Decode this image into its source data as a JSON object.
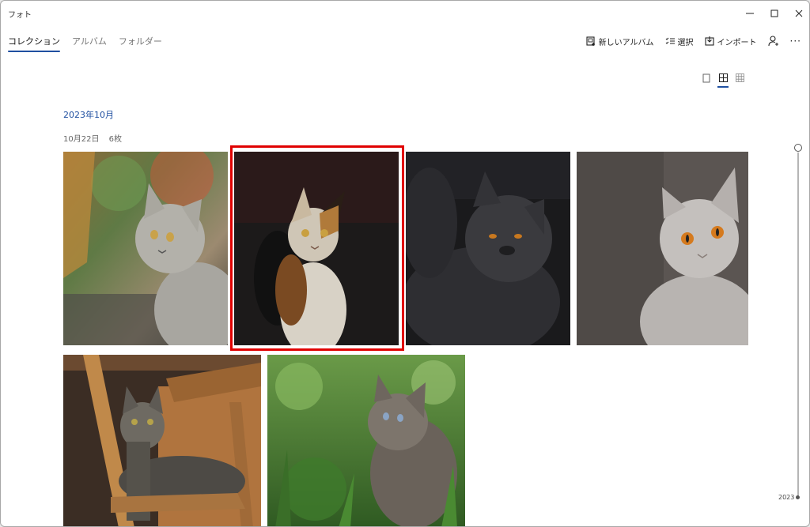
{
  "app": {
    "title": "フォト"
  },
  "window_controls": {
    "minimize_icon": "minimize-icon",
    "maximize_icon": "maximize-icon",
    "close_icon": "close-icon"
  },
  "tabs": [
    {
      "label": "コレクション",
      "active": true
    },
    {
      "label": "アルバム",
      "active": false
    },
    {
      "label": "フォルダー",
      "active": false
    }
  ],
  "commands": {
    "new_album": {
      "label": "新しいアルバム",
      "icon": "new-album-icon"
    },
    "select": {
      "label": "選択",
      "icon": "select-icon"
    },
    "import": {
      "label": "インポート",
      "icon": "import-icon"
    },
    "account": {
      "icon": "account-icon"
    },
    "more": {
      "label": "···",
      "icon": "more-icon"
    }
  },
  "view_modes": [
    "single-view-icon",
    "medium-grid-icon",
    "small-grid-icon"
  ],
  "active_view_mode": "medium-grid-icon",
  "gallery": {
    "month": "2023年10月",
    "day": {
      "date": "10月22日",
      "count": "6枚"
    },
    "photos": [
      {
        "subject": "gray cat by window with plants"
      },
      {
        "subject": "calico cat in dark room",
        "selected": true
      },
      {
        "subject": "black fluffy cat"
      },
      {
        "subject": "gray British shorthair with orange eyes"
      },
      {
        "subject": "tabby cat on wooden chair"
      },
      {
        "subject": "tabby kitten in green grass"
      }
    ]
  },
  "timeline": {
    "year": "2023"
  },
  "colors": {
    "accent": "#1f4fa0",
    "selection": "#e00000"
  }
}
